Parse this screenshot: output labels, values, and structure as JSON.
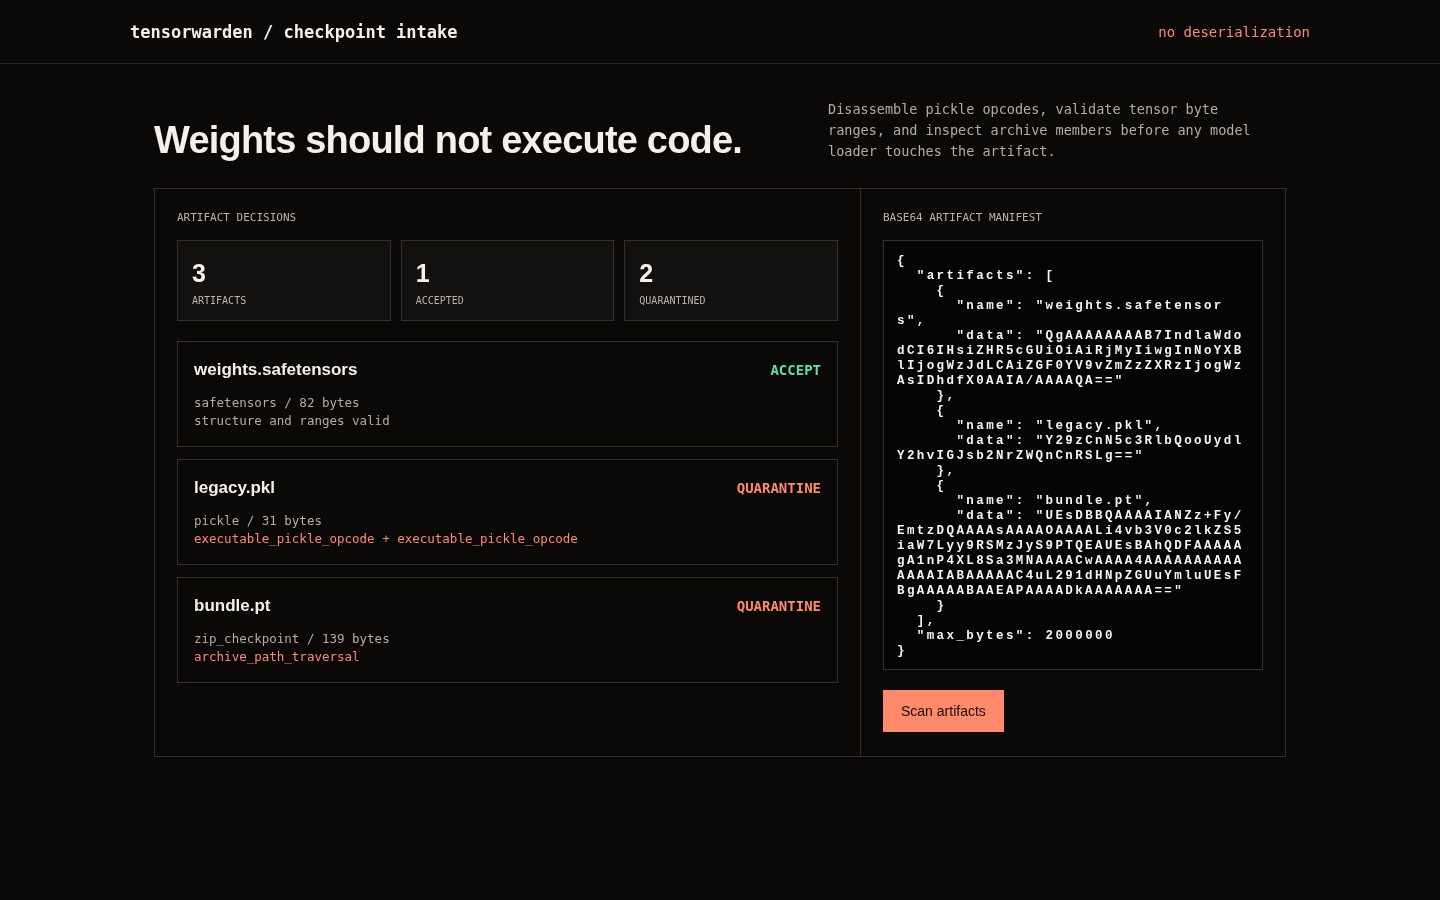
{
  "header": {
    "brand": "tensorwarden / checkpoint intake",
    "badge": "no deserialization"
  },
  "hero": {
    "title": "Weights should not execute code.",
    "description": "Disassemble pickle opcodes, validate tensor byte ranges, and inspect archive members before any model loader touches the artifact."
  },
  "decisions": {
    "heading": "ARTIFACT DECISIONS",
    "stats": [
      {
        "value": "3",
        "label": "ARTIFACTS"
      },
      {
        "value": "1",
        "label": "ACCEPTED"
      },
      {
        "value": "2",
        "label": "QUARANTINED"
      }
    ],
    "artifacts": [
      {
        "name": "weights.safetensors",
        "kind": "accept",
        "verdict": "ACCEPT",
        "meta": "safetensors / 82 bytes",
        "detail": "structure and ranges valid"
      },
      {
        "name": "legacy.pkl",
        "kind": "quarantine",
        "verdict": "QUARANTINE",
        "meta": "pickle / 31 bytes",
        "detail": "executable_pickle_opcode + executable_pickle_opcode"
      },
      {
        "name": "bundle.pt",
        "kind": "quarantine",
        "verdict": "QUARANTINE",
        "meta": "zip_checkpoint / 139 bytes",
        "detail": "archive_path_traversal"
      }
    ]
  },
  "manifest": {
    "heading": "BASE64 ARTIFACT MANIFEST",
    "value": "{\n  \"artifacts\": [\n    {\n      \"name\": \"weights.safetensors\",\n      \"data\": \"QgAAAAAAAAB7IndlaWdodCI6IHsiZHR5cGUiOiAiRjMyIiwgInNoYXBlIjogWzJdLCAiZGF0YV9vZmZzZXRzIjogWzAsIDhdfX0AAIA/AAAAQA==\"\n    },\n    {\n      \"name\": \"legacy.pkl\",\n      \"data\": \"Y29zCnN5c3RlbQooUydlY2hvIGJsb2NrZWQnCnRSLg==\"\n    },\n    {\n      \"name\": \"bundle.pt\",\n      \"data\": \"UEsDBBQAAAAIANZz+Fy/EmtzDQAAAAsAAAAOAAAALi4vb3V0c2lkZS5iaW7Lyy9RSMzJyS9PTQEAUEsBAhQDFAAAAAgA1nP4XL8Sa3MNAAAACwAAAA4AAAAAAAAAAAAAAIABAAAAAC4uL291dHNpZGUuYmluUEsFBgAAAAABAAEAPAAAADkAAAAAAA==\"\n    }\n  ],\n  \"max_bytes\": 2000000\n}",
    "button": "Scan artifacts"
  }
}
